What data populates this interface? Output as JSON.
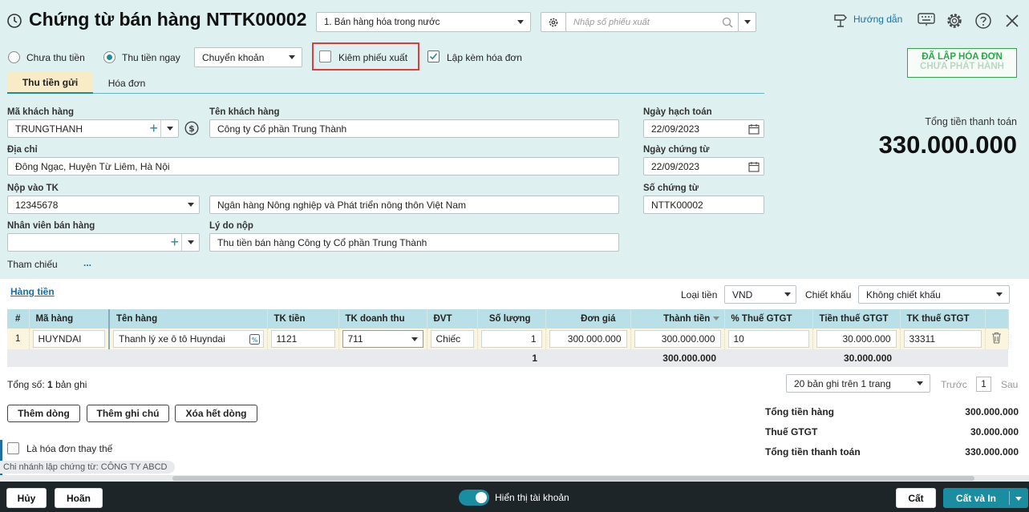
{
  "header": {
    "title": "Chứng từ bán hàng NTTK00002",
    "type_select": "1. Bán hàng hóa trong nước",
    "search_placeholder": "Nhập số phiếu xuất",
    "help_label": "Hướng dẫn"
  },
  "options": {
    "radio_unpaid": "Chưa thu tiền",
    "radio_paid": "Thu tiền ngay",
    "payment_method": "Chuyển khoản",
    "chk_export_note": "Kiêm phiếu xuất",
    "chk_invoice": "Lập kèm hóa đơn"
  },
  "stamp": {
    "line1": "ĐÃ LẬP HÓA ĐƠN",
    "line2": "CHƯA PHÁT HÀNH"
  },
  "tabs": [
    "Thu tiền gửi",
    "Hóa đơn"
  ],
  "form": {
    "customer_code_label": "Mã khách hàng",
    "customer_code": "TRUNGTHANH",
    "customer_name_label": "Tên khách hàng",
    "customer_name": "Công ty Cổ phần Trung Thành",
    "address_label": "Địa chỉ",
    "address": "Đông Ngạc, Huyện Từ Liêm, Hà Nội",
    "account_label": "Nộp vào TK",
    "account": "12345678",
    "bank_name": "Ngân hàng Nông nghiệp và Phát triển nông thôn Việt Nam",
    "salesperson_label": "Nhân viên bán hàng",
    "salesperson": "",
    "reason_label": "Lý do nộp",
    "reason": "Thu tiền bán hàng Công ty Cổ phần Trung Thành",
    "reference_label": "Tham chiếu",
    "reference_more": "...",
    "posting_date_label": "Ngày hạch toán",
    "posting_date": "22/09/2023",
    "voucher_date_label": "Ngày chứng từ",
    "voucher_date": "22/09/2023",
    "voucher_no_label": "Số chứng từ",
    "voucher_no": "NTTK00002"
  },
  "total": {
    "label": "Tổng tiền thanh toán",
    "value": "330.000.000"
  },
  "grid_bar": {
    "section_link": "Hàng tiền",
    "currency_label": "Loại tiền",
    "currency": "VND",
    "discount_label": "Chiết khấu",
    "discount": "Không chiết khấu"
  },
  "table": {
    "headers": [
      "#",
      "Mã hàng",
      "Tên hàng",
      "TK tiền",
      "TK doanh thu",
      "ĐVT",
      "Số lượng",
      "Đơn giá",
      "Thành tiền",
      "% Thuế GTGT",
      "Tiền thuế GTGT",
      "TK thuế GTGT"
    ],
    "rows": [
      {
        "no": "1",
        "code": "HUYNDAI",
        "name": "Thanh lý xe ô tô Huyndai",
        "cash_acc": "1121",
        "rev_acc": "711",
        "unit": "Chiếc",
        "qty": "1",
        "price": "300.000.000",
        "amount": "300.000.000",
        "vat_rate": "10",
        "vat_amount": "30.000.000",
        "vat_acc": "33311"
      }
    ],
    "sum": {
      "qty": "1",
      "amount": "300.000.000",
      "vat_amount": "30.000.000"
    }
  },
  "paging": {
    "record_prefix": "Tổng số:",
    "record_count": "1",
    "record_suffix": "bản ghi",
    "page_size": "20 bản ghi trên 1 trang",
    "prev": "Trước",
    "page": "1",
    "next": "Sau"
  },
  "actions": {
    "add_row": "Thêm dòng",
    "add_note": "Thêm ghi chú",
    "delete_all": "Xóa hết dòng"
  },
  "summary": [
    {
      "label": "Tổng tiền hàng",
      "value": "300.000.000"
    },
    {
      "label": "Thuế GTGT",
      "value": "30.000.000"
    },
    {
      "label": "Tổng tiền thanh toán",
      "value": "330.000.000"
    }
  ],
  "replacement_invoice": "Là hóa đơn thay thế",
  "branch_note": "Chi nhánh lập chứng từ: CÔNG TY ABCD",
  "footer": {
    "cancel": "Hủy",
    "defer": "Hoãn",
    "show_accounts": "Hiển thị tài khoản",
    "save": "Cất",
    "save_print": "Cất và In"
  },
  "colors": {
    "header_bg": "#dff0f1",
    "accent": "#1a8da0",
    "grid_header": "#b8e0e6",
    "stamp_green": "#2aa84a",
    "footer_bg": "#1e2529"
  }
}
